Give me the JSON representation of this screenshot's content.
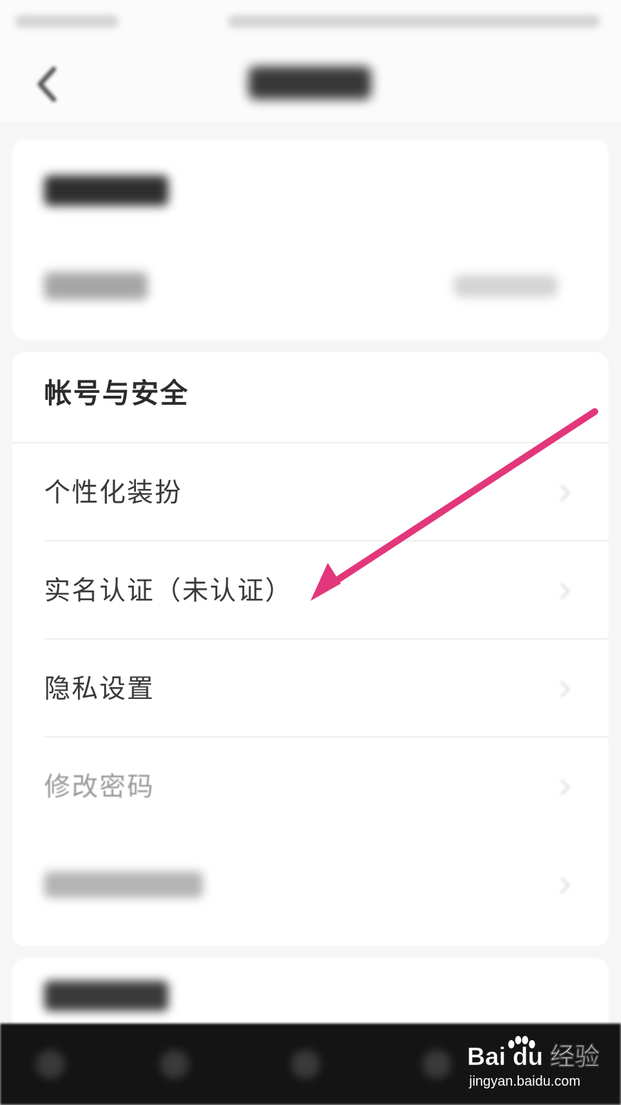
{
  "section": {
    "title": "帐号与安全",
    "items": [
      {
        "label": "个性化装扮"
      },
      {
        "label": "实名认证（未认证）"
      },
      {
        "label": "隐私设置"
      },
      {
        "label": "修改密码"
      }
    ]
  },
  "icons": {
    "back": "chevron-left-icon",
    "row": "chevron-right-icon"
  },
  "colors": {
    "annotation_arrow": "#e2377a",
    "background": "#f6f6f6",
    "card": "#ffffff"
  },
  "watermark": {
    "brand": "Bai du 经验",
    "url": "jingyan.baidu.com"
  }
}
